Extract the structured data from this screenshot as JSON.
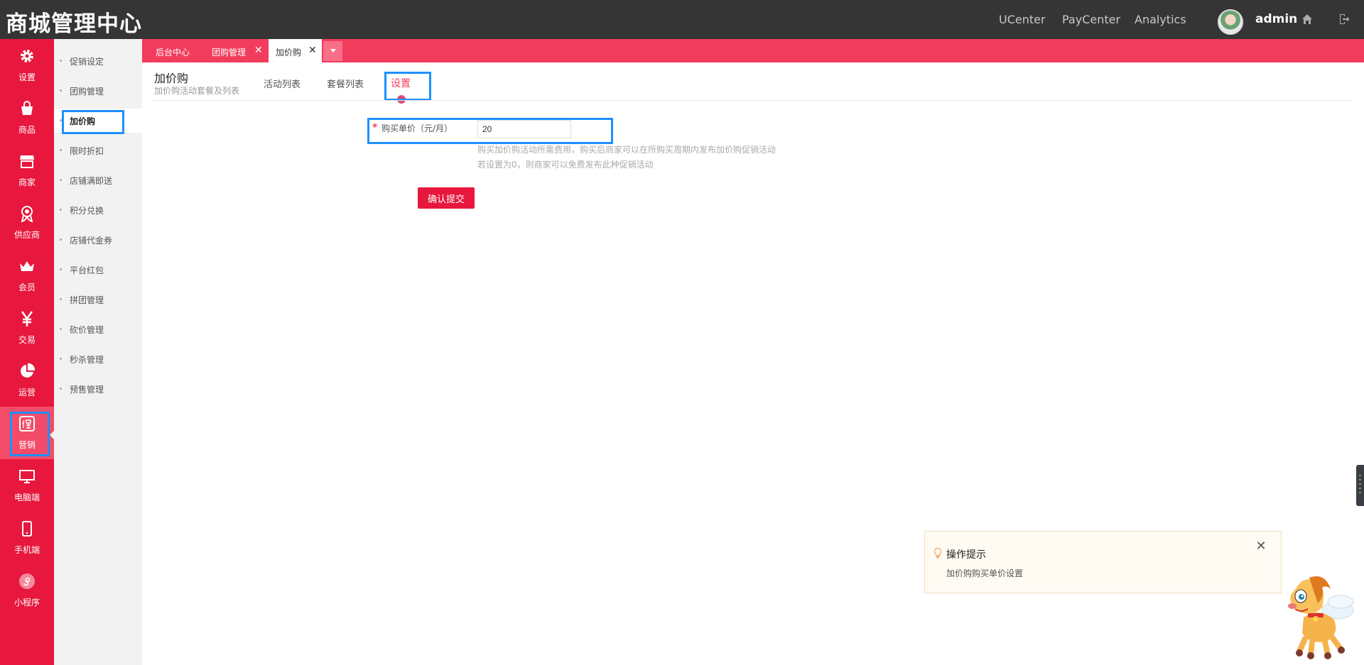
{
  "header": {
    "brand": "商城管理中心",
    "nav": [
      "UCenter",
      "PayCenter",
      "Analytics"
    ],
    "user": "admin"
  },
  "rail": {
    "items": [
      {
        "label": "设置",
        "icon": "gear-icon"
      },
      {
        "label": "商品",
        "icon": "shopping-bag-icon"
      },
      {
        "label": "商家",
        "icon": "store-icon"
      },
      {
        "label": "供应商",
        "icon": "award-ribbon-icon"
      },
      {
        "label": "会员",
        "icon": "crown-icon"
      },
      {
        "label": "交易",
        "icon": "yen-icon"
      },
      {
        "label": "运营",
        "icon": "pie-chart-icon"
      },
      {
        "label": "营销",
        "icon": "promotion-icon"
      },
      {
        "label": "电脑端",
        "icon": "monitor-icon"
      },
      {
        "label": "手机端",
        "icon": "mobile-icon"
      },
      {
        "label": "小程序",
        "icon": "mini-program-icon"
      }
    ],
    "active_index": 7
  },
  "submenu": {
    "items": [
      "促销设定",
      "团购管理",
      "加价购",
      "限时折扣",
      "店铺满即送",
      "积分兑换",
      "店铺代金券",
      "平台红包",
      "拼团管理",
      "砍价管理",
      "秒杀管理",
      "预售管理"
    ],
    "active_index": 2
  },
  "tabs": [
    {
      "label": "后台中心",
      "closable": false
    },
    {
      "label": "团购管理",
      "closable": true
    },
    {
      "label": "加价购",
      "closable": true,
      "active": true
    }
  ],
  "page": {
    "title": "加价购",
    "description": "加价购活动套餐及列表",
    "subnav": [
      "活动列表",
      "套餐列表",
      "设置"
    ],
    "subnav_active": "设置"
  },
  "form": {
    "price_label": "购买单价（元/月）",
    "price_value": "20",
    "hint_line1": "购买加价购活动所需费用，购买后商家可以在所购买周期内发布加价购促销活动",
    "hint_line2": "若设置为0，则商家可以免费发布此种促销活动",
    "submit_label": "确认提交"
  },
  "toast": {
    "title": "操作提示",
    "text": "加价购购买单价设置"
  },
  "colors": {
    "accent": "#e8173d",
    "tabbar": "#f23c5d",
    "topbar": "#353535",
    "highlight": "#1e90ff"
  }
}
